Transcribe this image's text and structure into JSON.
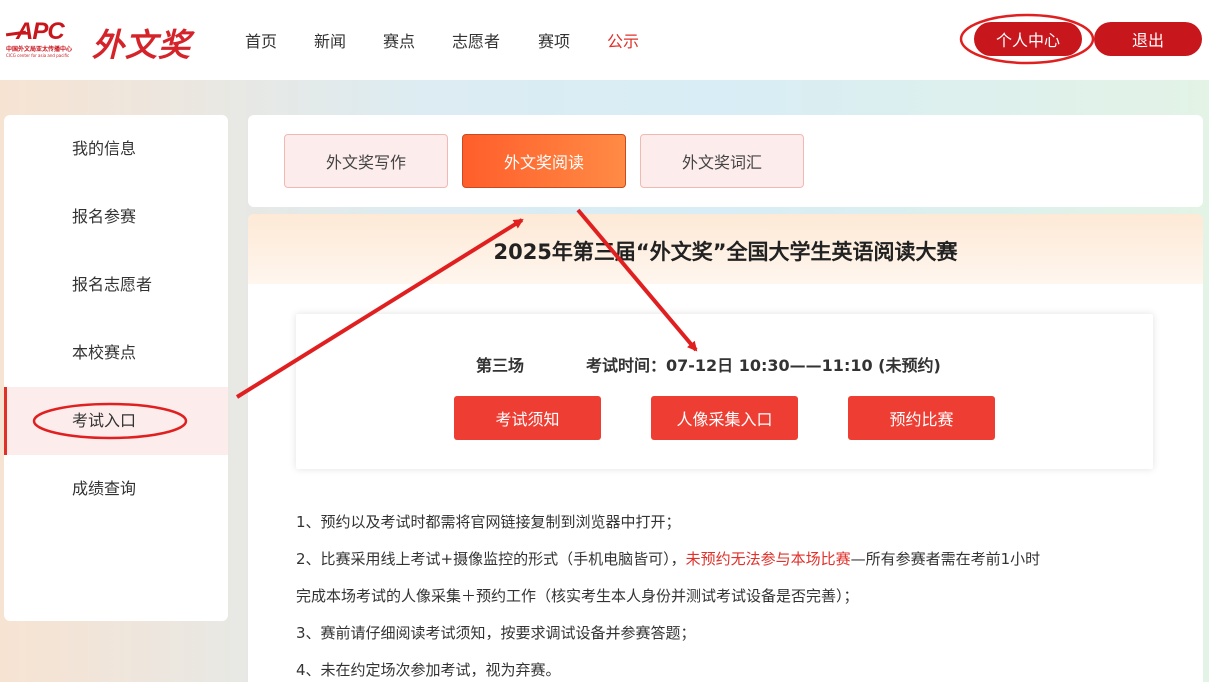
{
  "logo": {
    "apc": "APC",
    "org_cn": "中国外文局亚太传播中心",
    "org_en": "CICG center for asia and pacific",
    "brand": "外文奖"
  },
  "nav": [
    {
      "label": "首页",
      "active": false
    },
    {
      "label": "新闻",
      "active": false
    },
    {
      "label": "赛点",
      "active": false
    },
    {
      "label": "志愿者",
      "active": false
    },
    {
      "label": "赛项",
      "active": false
    },
    {
      "label": "公示",
      "active": true
    }
  ],
  "header_buttons": {
    "personal_center": "个人中心",
    "logout": "退出"
  },
  "sidebar": {
    "items": [
      {
        "label": "我的信息"
      },
      {
        "label": "报名参赛"
      },
      {
        "label": "报名志愿者"
      },
      {
        "label": "本校赛点"
      },
      {
        "label": "考试入口",
        "active": true
      },
      {
        "label": "成绩查询"
      }
    ]
  },
  "tabs": [
    {
      "label": "外文奖写作",
      "active": false
    },
    {
      "label": "外文奖阅读",
      "active": true
    },
    {
      "label": "外文奖词汇",
      "active": false
    }
  ],
  "main": {
    "title": "2025年第三届“外文奖”全国大学生英语阅读大赛",
    "session": {
      "name": "第三场",
      "time": "考试时间：07-12日 10:30——11:10 (未预约)"
    },
    "buttons": {
      "notice": "考试须知",
      "face_capture": "人像采集入口",
      "reserve": "预约比赛"
    },
    "notes": {
      "n1": "1、预约以及考试时都需将官网链接复制到浏览器中打开；",
      "n2_a": "2、比赛采用线上考试+摄像监控的形式（手机电脑皆可），",
      "n2_warn": "未预约无法参与本场比赛",
      "n2_b": "—所有参赛者需在考前1小时",
      "n2_c": "完成本场考试的人像采集＋预约工作（核实考生本人身份并测试考试设备是否完善）；",
      "n3": "3、赛前请仔细阅读考试须知，按要求调试设备并参赛答题；",
      "n4": "4、未在约定场次参加考试，视为弃赛。"
    }
  },
  "colors": {
    "brand_red": "#c8161d",
    "accent_red": "#e0302a",
    "button_red": "#ee3e33",
    "active_tab_orange": "#ff6a33",
    "annotation_red": "#e02020"
  }
}
